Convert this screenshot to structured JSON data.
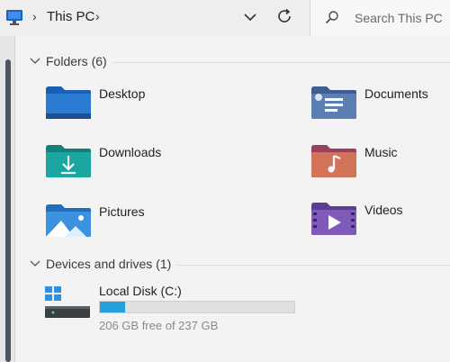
{
  "address_bar": {
    "location": "This PC",
    "search_placeholder": "Search This PC",
    "icons": [
      "monitor-icon",
      "chevron-right-icon",
      "chevron-down-icon",
      "refresh-icon",
      "search-icon"
    ]
  },
  "sections": {
    "folders": {
      "title": "Folders (6)",
      "items": [
        {
          "label": "Desktop",
          "icon": "desktop-folder-icon",
          "color": "#2b7bd3"
        },
        {
          "label": "Documents",
          "icon": "documents-folder-icon",
          "color": "#5b7fb3"
        },
        {
          "label": "Downloads",
          "icon": "downloads-folder-icon",
          "color": "#1aa7a2"
        },
        {
          "label": "Music",
          "icon": "music-folder-icon",
          "color": "#d2745a"
        },
        {
          "label": "Pictures",
          "icon": "pictures-folder-icon",
          "color": "#3b93e0"
        },
        {
          "label": "Videos",
          "icon": "videos-folder-icon",
          "color": "#7f5ab8"
        }
      ]
    },
    "drives": {
      "title": "Devices and drives (1)",
      "items": [
        {
          "label": "Local Disk (C:)",
          "free_text": "206 GB free of 237 GB",
          "used_fraction": 0.131,
          "icon": "windows-drive-icon",
          "bar_color": "#26a0da"
        }
      ]
    }
  }
}
